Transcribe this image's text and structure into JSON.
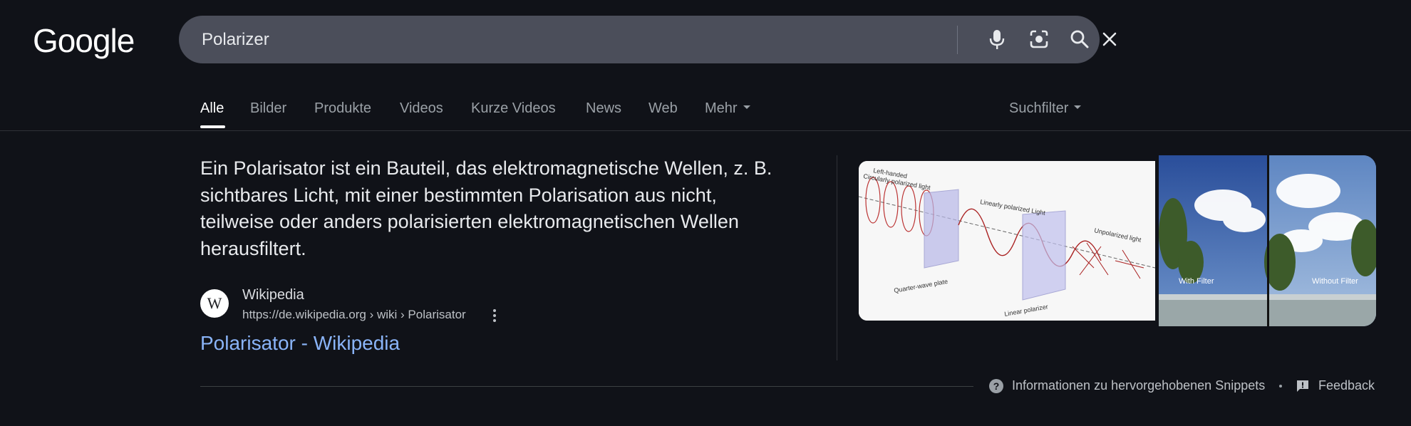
{
  "header": {
    "logo_text": "Google",
    "search": {
      "value": "Polarizer",
      "clear_icon": "close-icon",
      "mic_icon": "microphone-icon",
      "lens_icon": "camera-lens-icon",
      "search_icon": "search-icon"
    }
  },
  "tabs": {
    "items": [
      {
        "label": "Alle",
        "active": true
      },
      {
        "label": "Bilder"
      },
      {
        "label": "Produkte"
      },
      {
        "label": "Videos"
      },
      {
        "label": "Kurze Videos"
      },
      {
        "label": "News"
      },
      {
        "label": "Web"
      },
      {
        "label": "Mehr"
      }
    ],
    "filter_label": "Suchfilter"
  },
  "snippet": {
    "text": "Ein Polarisator ist ein Bauteil, das elektromagnetische Wellen, z. B. sichtbares Licht, mit einer bestimmten Polarisation aus nicht, teilweise oder anders polarisierten elektromagnetischen Wellen herausfiltert.",
    "source": {
      "favicon_letter": "W",
      "name": "Wikipedia",
      "url": "https://de.wikipedia.org › wiki › Polarisator"
    },
    "link_title": "Polarisator - Wikipedia"
  },
  "images": {
    "diagram_labels": {
      "left_handed": "Left-handed",
      "circular": "Circularly polarized light",
      "linear": "Linearly polarized Light",
      "unpolarized": "Unpolarized light",
      "quarter_wave": "Quarter-wave plate",
      "linear_polarizer": "Linear polarizer"
    },
    "photo_labels": {
      "with_filter": "With Filter",
      "without_filter": "Without Filter"
    }
  },
  "footer": {
    "info_label": "Informationen zu hervorgehobenen Snippets",
    "feedback_label": "Feedback"
  },
  "colors": {
    "background": "#101218",
    "searchbar": "#4b4e5a",
    "link": "#8ab4f8"
  }
}
